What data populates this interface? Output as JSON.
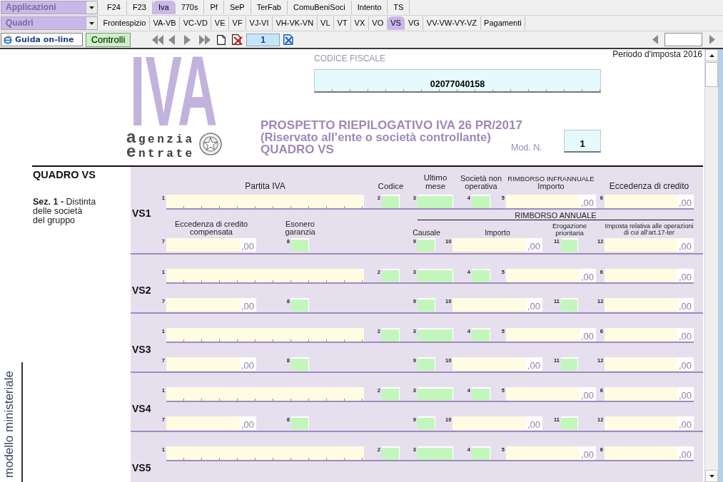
{
  "app_bar": {
    "applications_dropdown": "Applicazioni",
    "app_tabs": [
      {
        "label": "F24",
        "selected": false
      },
      {
        "label": "F23",
        "selected": false
      },
      {
        "label": "Iva",
        "selected": true
      },
      {
        "label": "770s",
        "selected": false
      },
      {
        "label": "Pf",
        "selected": false
      },
      {
        "label": "SeP",
        "selected": false
      },
      {
        "label": "TerFab",
        "selected": false
      },
      {
        "label": "ComuBeniSoci",
        "selected": false
      },
      {
        "label": "Intento",
        "selected": false
      },
      {
        "label": "TS",
        "selected": false
      }
    ],
    "sections_dropdown": "Quadri",
    "section_tabs": [
      {
        "label": "Frontespizio",
        "selected": false
      },
      {
        "label": "VA-VB",
        "selected": false
      },
      {
        "label": "VC-VD",
        "selected": false
      },
      {
        "label": "VE",
        "selected": false
      },
      {
        "label": "VF",
        "selected": false
      },
      {
        "label": "VJ-VI",
        "selected": false
      },
      {
        "label": "VH-VK-VN",
        "selected": false
      },
      {
        "label": "VL",
        "selected": false
      },
      {
        "label": "VT",
        "selected": false
      },
      {
        "label": "VX",
        "selected": false
      },
      {
        "label": "VO",
        "selected": false
      },
      {
        "label": "VS",
        "selected": true
      },
      {
        "label": "VG",
        "selected": false
      },
      {
        "label": "VV-VW-VY-VZ",
        "selected": false
      },
      {
        "label": "Pagamenti",
        "selected": false
      }
    ]
  },
  "toolbar": {
    "help_button": "Guida on-line",
    "checks_button": "Controlli",
    "page_number": "1"
  },
  "document": {
    "period": "Periodo d'imposta 2016",
    "logo_text": "IVA",
    "agency_logo": [
      {
        "initial": "a",
        "text": "genzia"
      },
      {
        "initial": "e",
        "text": "ntrate"
      }
    ],
    "tax_code_label": "CODICE FISCALE",
    "tax_code": "02077040158",
    "title": "PROSPETTO RIEPILOGATIVO IVA 26 PR/2017",
    "subtitle": "(Riservato all’ente o società controllante)",
    "quadro": "QUADRO VS",
    "model_label": "Mod. N.",
    "model_number": "1"
  },
  "form": {
    "title": "QUADRO VS",
    "section": "**Sez. 1 -** Distinta\ndelle società\ndel gruppo",
    "side_label": "modello ministeriale",
    "headings_1": [
      {
        "label": "Partita IVA"
      },
      {
        "label": "Codice"
      },
      {
        "label": "Ultimo\nmese"
      },
      {
        "label": "Società non\noperativa"
      },
      {
        "group": "RIMBORSO INFRANNUALE",
        "label": "Importo"
      },
      {
        "label": "Eccedenza di credito"
      }
    ],
    "group_heading_2": "RIMBORSO ANNUALE",
    "headings_2": [
      {
        "label": "Eccedenza di credito\ncompensata"
      },
      {
        "label": "Esonero\ngaranzia"
      },
      {
        "label": "Causale"
      },
      {
        "label": "Importo"
      },
      {
        "label": "Erogazione\nprioritaria"
      },
      {
        "label": "Imposta relativa alle operazioni\ndi cui all’art.17-ter"
      }
    ],
    "rows": [
      {
        "code": "VS1",
        "line_1": [
          {
            "number": "1",
            "kind": "id"
          },
          {
            "number": "2",
            "kind": "choice"
          },
          {
            "number": "3",
            "kind": "choice"
          },
          {
            "number": "4",
            "kind": "choice"
          },
          {
            "number": "5",
            "kind": "amount",
            "value": ",00"
          },
          {
            "number": "6",
            "kind": "amount",
            "value": ",00"
          }
        ],
        "line_2": [
          {
            "number": "7",
            "kind": "amount",
            "value": ",00"
          },
          {
            "number": "8",
            "kind": "choice"
          },
          {
            "number": "9",
            "kind": "choice"
          },
          {
            "number": "10",
            "kind": "amount",
            "value": ",00"
          },
          {
            "number": "11",
            "kind": "choice"
          },
          {
            "number": "12",
            "kind": "amount",
            "value": ",00"
          }
        ]
      },
      {
        "code": "VS2",
        "line_1": [
          {
            "number": "1",
            "kind": "id"
          },
          {
            "number": "2",
            "kind": "choice"
          },
          {
            "number": "3",
            "kind": "choice"
          },
          {
            "number": "4",
            "kind": "choice"
          },
          {
            "number": "5",
            "kind": "amount",
            "value": ",00"
          },
          {
            "number": "6",
            "kind": "amount",
            "value": ",00"
          }
        ],
        "line_2": [
          {
            "number": "7",
            "kind": "amount",
            "value": ",00"
          },
          {
            "number": "8",
            "kind": "choice"
          },
          {
            "number": "9",
            "kind": "choice"
          },
          {
            "number": "10",
            "kind": "amount",
            "value": ",00"
          },
          {
            "number": "11",
            "kind": "choice"
          },
          {
            "number": "12",
            "kind": "amount",
            "value": ",00"
          }
        ]
      },
      {
        "code": "VS3",
        "line_1": [
          {
            "number": "1",
            "kind": "id"
          },
          {
            "number": "2",
            "kind": "choice"
          },
          {
            "number": "3",
            "kind": "choice"
          },
          {
            "number": "4",
            "kind": "choice"
          },
          {
            "number": "5",
            "kind": "amount",
            "value": ",00"
          },
          {
            "number": "6",
            "kind": "amount",
            "value": ",00"
          }
        ],
        "line_2": [
          {
            "number": "7",
            "kind": "amount",
            "value": ",00"
          },
          {
            "number": "8",
            "kind": "choice"
          },
          {
            "number": "9",
            "kind": "choice"
          },
          {
            "number": "10",
            "kind": "amount",
            "value": ",00"
          },
          {
            "number": "11",
            "kind": "choice"
          },
          {
            "number": "12",
            "kind": "amount",
            "value": ",00"
          }
        ]
      },
      {
        "code": "VS4",
        "line_1": [
          {
            "number": "1",
            "kind": "id"
          },
          {
            "number": "2",
            "kind": "choice"
          },
          {
            "number": "3",
            "kind": "choice"
          },
          {
            "number": "4",
            "kind": "choice"
          },
          {
            "number": "5",
            "kind": "amount",
            "value": ",00"
          },
          {
            "number": "6",
            "kind": "amount",
            "value": ",00"
          }
        ],
        "line_2": [
          {
            "number": "7",
            "kind": "amount",
            "value": ",00"
          },
          {
            "number": "8",
            "kind": "choice"
          },
          {
            "number": "9",
            "kind": "choice"
          },
          {
            "number": "10",
            "kind": "amount",
            "value": ",00"
          },
          {
            "number": "11",
            "kind": "choice"
          },
          {
            "number": "12",
            "kind": "amount",
            "value": ",00"
          }
        ]
      },
      {
        "code": "VS5",
        "line_1": [
          {
            "number": "1",
            "kind": "id"
          },
          {
            "number": "2",
            "kind": "choice"
          },
          {
            "number": "3",
            "kind": "choice"
          },
          {
            "number": "4",
            "kind": "choice"
          },
          {
            "number": "5",
            "kind": "amount",
            "value": ",00"
          },
          {
            "number": "6",
            "kind": "amount",
            "value": ",00"
          }
        ]
      }
    ]
  }
}
